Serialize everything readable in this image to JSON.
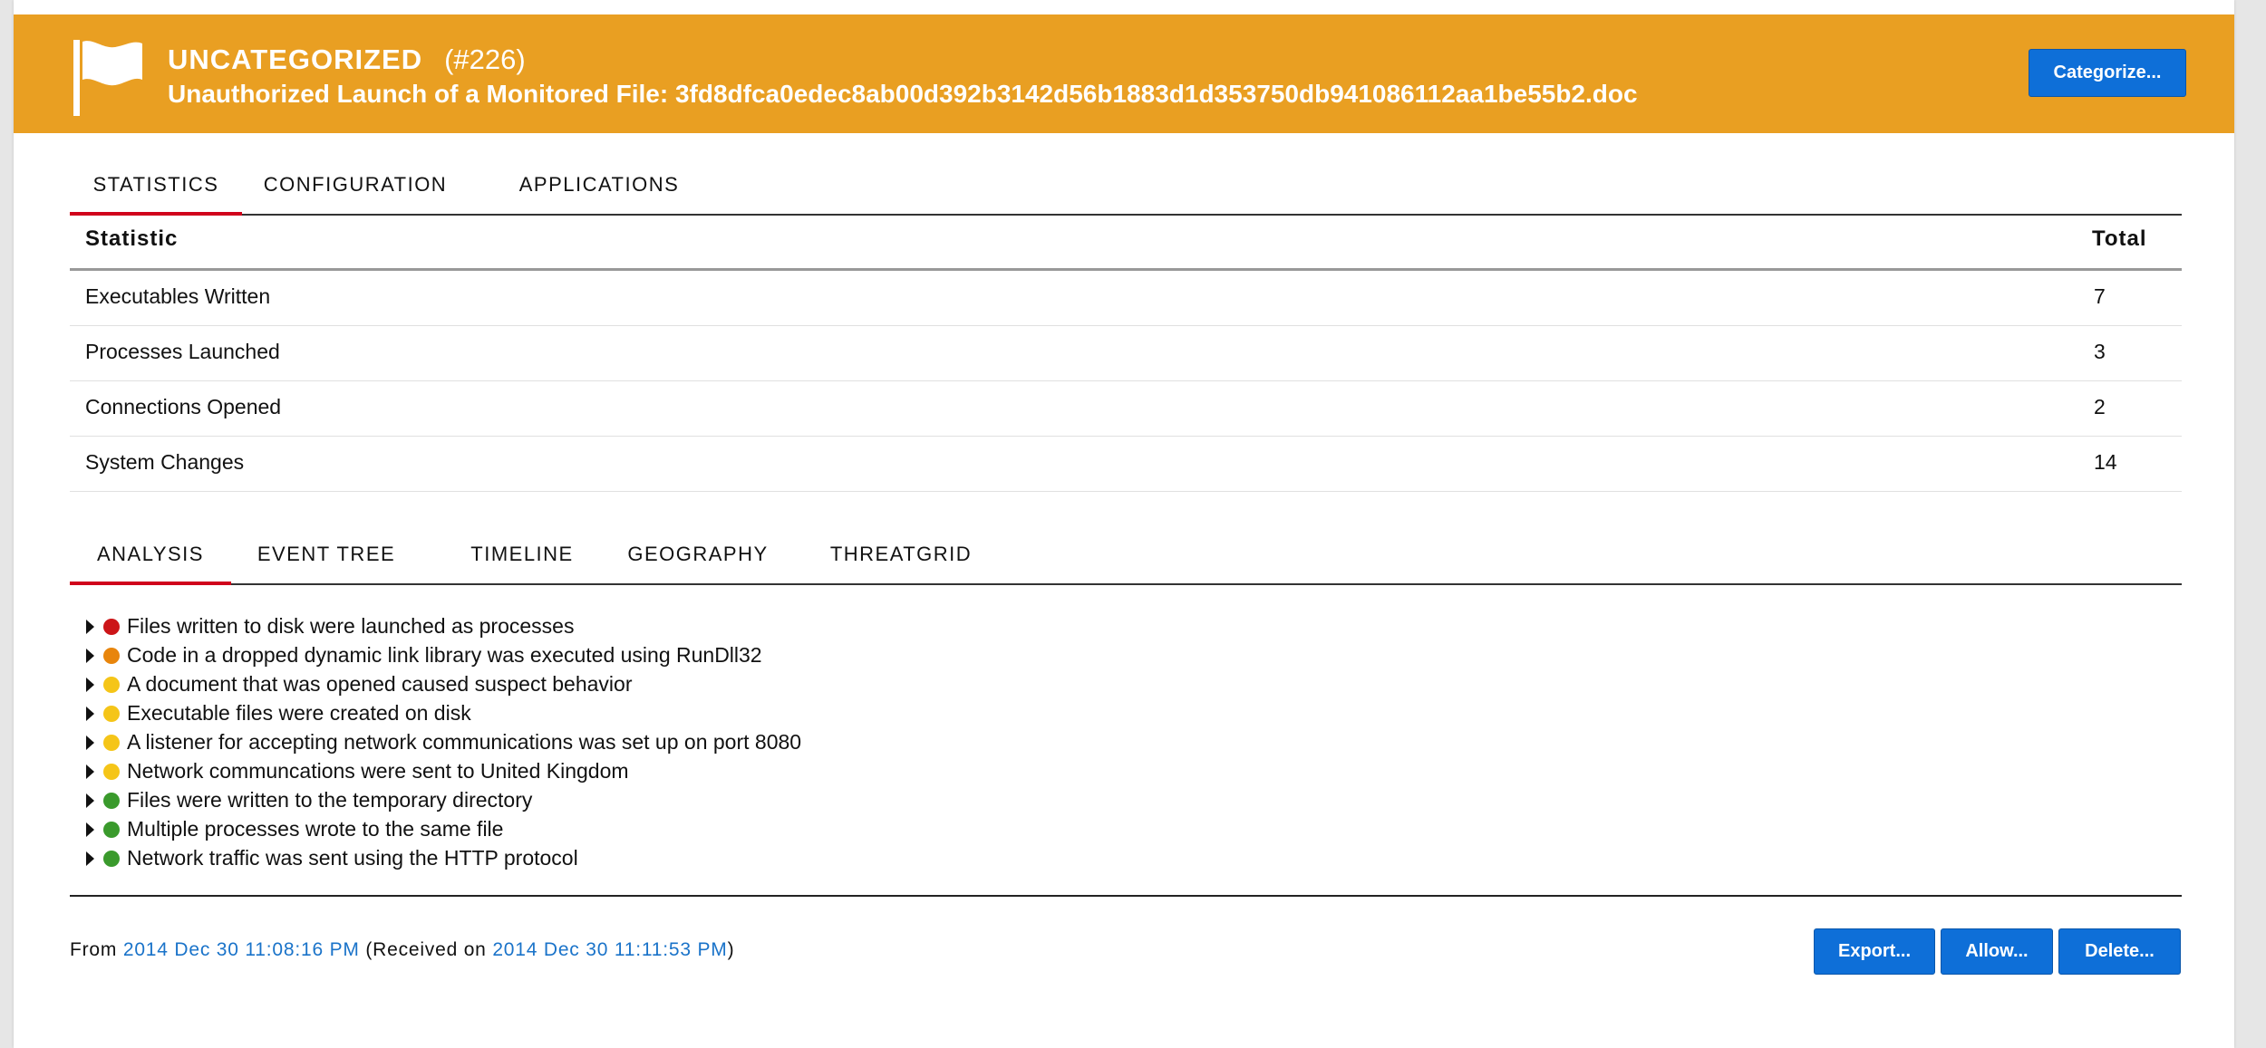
{
  "banner": {
    "category": "UNCATEGORIZED",
    "number": "(#226)",
    "title": "Unauthorized Launch of a Monitored File: 3fd8dfca0edec8ab00d392b3142d56b1883d1d353750db941086112aa1be55b2.doc",
    "categorize_label": "Categorize...",
    "color": "#e99f22"
  },
  "top_tabs": [
    {
      "label": "STATISTICS",
      "active": true
    },
    {
      "label": "CONFIGURATION",
      "active": false
    },
    {
      "label": "APPLICATIONS",
      "active": false
    }
  ],
  "stats": {
    "headers": [
      "Statistic",
      "Total"
    ],
    "rows": [
      {
        "name": "Executables Written",
        "total": "7"
      },
      {
        "name": "Processes Launched",
        "total": "3"
      },
      {
        "name": "Connections Opened",
        "total": "2"
      },
      {
        "name": "System Changes",
        "total": "14"
      }
    ]
  },
  "bottom_tabs": [
    {
      "label": "ANALYSIS",
      "active": true
    },
    {
      "label": "EVENT TREE",
      "active": false
    },
    {
      "label": "TIMELINE",
      "active": false
    },
    {
      "label": "GEOGRAPHY",
      "active": false
    },
    {
      "label": "THREATGRID",
      "active": false
    }
  ],
  "analysis": [
    {
      "text": "Files written to disk were launched as processes",
      "severity": "red",
      "color": "#cc1518"
    },
    {
      "text": "Code in a dropped dynamic link library was executed using RunDll32",
      "severity": "orange",
      "color": "#e8850c"
    },
    {
      "text": "A document that was opened caused suspect behavior",
      "severity": "yellow",
      "color": "#f5c518"
    },
    {
      "text": "Executable files were created on disk",
      "severity": "yellow",
      "color": "#f5c518"
    },
    {
      "text": "A listener for accepting network communications was set up on port 8080",
      "severity": "yellow",
      "color": "#f5c518"
    },
    {
      "text": "Network communcations were sent to United Kingdom",
      "severity": "yellow",
      "color": "#f5c518"
    },
    {
      "text": "Files were written to the temporary directory",
      "severity": "green",
      "color": "#3a9a2c"
    },
    {
      "text": "Multiple processes wrote to the same file",
      "severity": "green",
      "color": "#3a9a2c"
    },
    {
      "text": "Network traffic was sent using the HTTP protocol",
      "severity": "green",
      "color": "#3a9a2c"
    }
  ],
  "footer": {
    "from_label": "From",
    "from_date": "2014 Dec 30 11:08:16 PM",
    "received_prefix": "(Received on",
    "received_date": "2014 Dec 30 11:11:53 PM",
    "received_suffix": ")",
    "export_label": "Export...",
    "allow_label": "Allow...",
    "delete_label": "Delete..."
  },
  "colors": {
    "accent_blue": "#0e6fd8",
    "tab_underline": "#d0021b",
    "link": "#1a73c9"
  }
}
